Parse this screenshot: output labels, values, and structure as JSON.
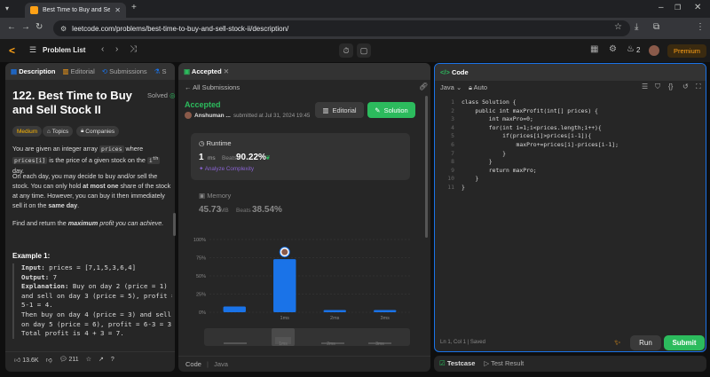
{
  "browser": {
    "tab_title": "Best Time to Buy and Sell Stoc",
    "url": "leetcode.com/problems/best-time-to-buy-and-sell-stock-ii/description/"
  },
  "nav": {
    "problem_list": "Problem List",
    "streak": "2",
    "premium": "Premium"
  },
  "left": {
    "tabs": [
      "Description",
      "Editorial",
      "Submissions",
      "S"
    ],
    "title": "122. Best Time to Buy and Sell Stock II",
    "solved": "Solved",
    "chips": [
      "Medium",
      "Topics",
      "Companies"
    ],
    "p1_a": "You are given an integer array ",
    "p1_code1": "prices",
    "p1_b": " where ",
    "p1_code2": "prices[i]",
    "p1_c": " is the price of a given stock on the ",
    "p1_code3": "i",
    "p1_sup": "th",
    "p1_d": " day.",
    "p2_a": "On each day, you may decide to buy and/or sell the stock. You can only hold ",
    "p2_bold": "at most one",
    "p2_b": " share of the stock at any time. However, you can buy it then immediately sell it on the ",
    "p2_bold2": "same day",
    "p2_c": ".",
    "p3_a": "Find and return the ",
    "p3_bi": "maximum",
    "p3_b": " profit you can achieve.",
    "example_title": "Example 1:",
    "example_lines": [
      {
        "label": "Input:",
        "text": " prices = [7,1,5,3,6,4]"
      },
      {
        "label": "Output:",
        "text": " 7"
      },
      {
        "label": "Explanation:",
        "text": " Buy on day 2 (price = 1)"
      },
      {
        "label": "",
        "text": "and sell on day 3 (price = 5), profit ="
      },
      {
        "label": "",
        "text": "5-1 = 4."
      },
      {
        "label": "",
        "text": "Then buy on day 4 (price = 3) and sell"
      },
      {
        "label": "",
        "text": "on day 5 (price = 6), profit = 6-3 = 3."
      },
      {
        "label": "",
        "text": "Total profit is 4 + 3 = 7."
      }
    ],
    "likes": "13.6K",
    "comments": "211"
  },
  "middle": {
    "tab": "Accepted",
    "all_submissions": "All Submissions",
    "status": "Accepted",
    "user": "Anshuman ...",
    "submitted": "submitted at Jul 31, 2024 19:45",
    "editorial_btn": "Editorial",
    "solution_btn": "Solution",
    "runtime_label": "Runtime",
    "runtime_value": "1",
    "runtime_unit": "ms",
    "beats_label": "Beats",
    "runtime_beats": "90.22%",
    "analyze": "Analyze Complexity",
    "memory_label": "Memory",
    "memory_value": "45.73",
    "memory_unit": "MB",
    "memory_beats": "38.54%",
    "footer_code": "Code",
    "footer_lang": "Java"
  },
  "chart_data": {
    "type": "bar",
    "categories": [
      "",
      "1ms",
      "2ms",
      "3ms"
    ],
    "values": [
      8,
      73,
      3,
      3
    ],
    "ylim": [
      0,
      100
    ],
    "yticks": [
      "0%",
      "25%",
      "50%",
      "75%",
      "100%"
    ],
    "highlight_index": 1,
    "accent": "#1a73e8",
    "mini_labels": [
      "1ms",
      "2ms",
      "3ms"
    ]
  },
  "right": {
    "tab": "Code",
    "lang": "Java",
    "auto": "Auto",
    "code_lines": [
      "class Solution {",
      "    public int maxProfit(int[] prices) {",
      "        int maxPro=0;",
      "        for(int i=1;i<prices.length;i++){",
      "            if(prices[i]>prices[i-1]){",
      "                maxPro+=prices[i]-prices[i-1];",
      "            }",
      "        }",
      "        return maxPro;",
      "    }",
      "}"
    ],
    "status": "Ln 1, Col 1  |  Saved",
    "run": "Run",
    "submit": "Submit",
    "testcase": "Testcase",
    "test_result": "Test Result"
  }
}
